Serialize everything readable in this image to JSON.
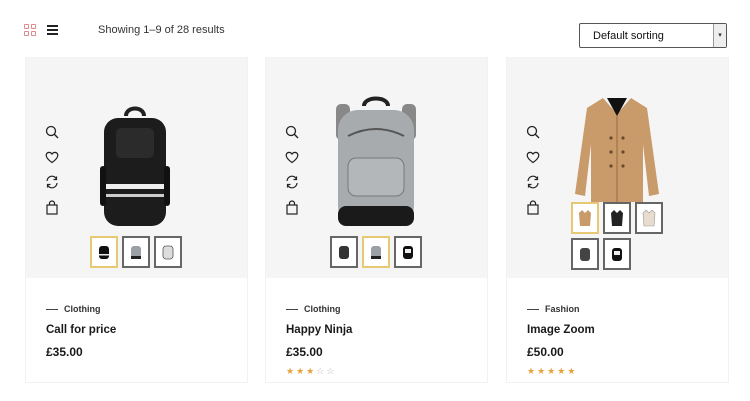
{
  "toolbar": {
    "result_count": "Showing 1–9 of 28 results",
    "sort_selected": "Default sorting",
    "grid_icon": "grid-view-icon",
    "list_icon": "list-view-icon"
  },
  "colors": {
    "accent_star": "#e6a23c",
    "active_thumb_border": "#e7c874",
    "grid_icon": "#e08a8a"
  },
  "products": [
    {
      "category": "Clothing",
      "title": "Call for price",
      "price": "£35.00",
      "rating": null,
      "thumbs": [
        "black-backpack",
        "gray-backpack",
        "white-backpack"
      ],
      "active_thumb": 0
    },
    {
      "category": "Clothing",
      "title": "Happy Ninja",
      "price": "£35.00",
      "rating": 3,
      "thumbs": [
        "black-backpack",
        "gray-backpack",
        "white-backpack"
      ],
      "active_thumb": 1
    },
    {
      "category": "Fashion",
      "title": "Image Zoom",
      "price": "£50.00",
      "rating": 5,
      "thumbs": [
        "tan-coat",
        "black-coat",
        "beige-coat",
        "gray-backpack",
        "black-backpack"
      ],
      "active_thumb": 0
    }
  ],
  "card_actions": [
    "quick-view-icon",
    "wishlist-icon",
    "compare-icon",
    "add-to-cart-icon"
  ]
}
